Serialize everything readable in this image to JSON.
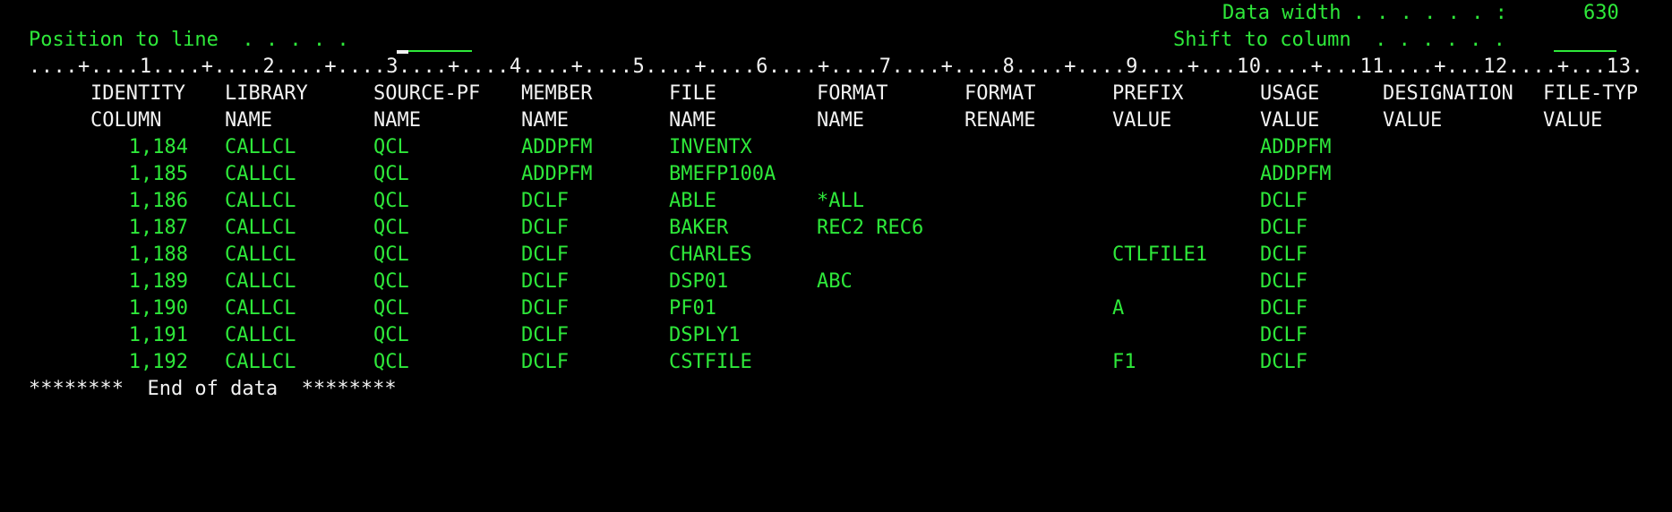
{
  "header": {
    "data_width_label": "Data width . . . . . . :",
    "data_width_value": "630",
    "position_label": "Position to line  . . . . .",
    "position_value": "",
    "shift_label": "Shift to column  . . . . . .",
    "shift_value": ""
  },
  "ruler": " . . . . + . . . . 1 . . . . + . . . . 2 . . . . + . . . . 3 . . . . + . . . . 4 . . . . + . . . . 5 . . . . + . . . . 6 . . . . + . . . . 7 . . . . + . . . . 8 . . . . + . . . . 9 . . . . + . . . 10 . . . . + . . . 11 . . . . + . . . 12 . . . . + . . . 13 .",
  "ruler_text": "....+....1....+....2....+....3....+....4....+....5....+....6....+....7....+....8....+....9....+...10....+...11....+...12....+...13.",
  "columns": [
    {
      "h1": "IDENTITY",
      "h2": "COLUMN"
    },
    {
      "h1": "LIBRARY",
      "h2": "NAME"
    },
    {
      "h1": "SOURCE-PF",
      "h2": "NAME"
    },
    {
      "h1": "MEMBER",
      "h2": "NAME"
    },
    {
      "h1": "FILE",
      "h2": "NAME"
    },
    {
      "h1": "FORMAT",
      "h2": "NAME"
    },
    {
      "h1": "FORMAT",
      "h2": "RENAME"
    },
    {
      "h1": "PREFIX",
      "h2": "VALUE"
    },
    {
      "h1": "USAGE",
      "h2": "VALUE"
    },
    {
      "h1": "DESIGNATION",
      "h2": "VALUE"
    },
    {
      "h1": "FILE-TYP",
      "h2": "VALUE"
    }
  ],
  "rows": [
    {
      "identity": "1,184",
      "library": "CALLCL",
      "source_pf": "QCL",
      "member": "ADDPFM",
      "file": "INVENTX",
      "format": "",
      "format_rename": "",
      "prefix": "",
      "usage": "ADDPFM",
      "designation": "",
      "file_type": ""
    },
    {
      "identity": "1,185",
      "library": "CALLCL",
      "source_pf": "QCL",
      "member": "ADDPFM",
      "file": "BMEFP100A",
      "format": "",
      "format_rename": "",
      "prefix": "",
      "usage": "ADDPFM",
      "designation": "",
      "file_type": ""
    },
    {
      "identity": "1,186",
      "library": "CALLCL",
      "source_pf": "QCL",
      "member": "DCLF",
      "file": "ABLE",
      "format": "*ALL",
      "format_rename": "",
      "prefix": "",
      "usage": "DCLF",
      "designation": "",
      "file_type": ""
    },
    {
      "identity": "1,187",
      "library": "CALLCL",
      "source_pf": "QCL",
      "member": "DCLF",
      "file": "BAKER",
      "format": "REC2 REC6",
      "format_rename": "",
      "prefix": "",
      "usage": "DCLF",
      "designation": "",
      "file_type": ""
    },
    {
      "identity": "1,188",
      "library": "CALLCL",
      "source_pf": "QCL",
      "member": "DCLF",
      "file": "CHARLES",
      "format": "",
      "format_rename": "",
      "prefix": "CTLFILE1",
      "usage": "DCLF",
      "designation": "",
      "file_type": ""
    },
    {
      "identity": "1,189",
      "library": "CALLCL",
      "source_pf": "QCL",
      "member": "DCLF",
      "file": "DSP01",
      "format": "ABC",
      "format_rename": "",
      "prefix": "",
      "usage": "DCLF",
      "designation": "",
      "file_type": ""
    },
    {
      "identity": "1,190",
      "library": "CALLCL",
      "source_pf": "QCL",
      "member": "DCLF",
      "file": "PF01",
      "format": "",
      "format_rename": "",
      "prefix": "A",
      "usage": "DCLF",
      "designation": "",
      "file_type": ""
    },
    {
      "identity": "1,191",
      "library": "CALLCL",
      "source_pf": "QCL",
      "member": "DCLF",
      "file": "DSPLY1",
      "format": "",
      "format_rename": "",
      "prefix": "",
      "usage": "DCLF",
      "designation": "",
      "file_type": ""
    },
    {
      "identity": "1,192",
      "library": "CALLCL",
      "source_pf": "QCL",
      "member": "DCLF",
      "file": "CSTFILE",
      "format": "",
      "format_rename": "",
      "prefix": "F1",
      "usage": "DCLF",
      "designation": "",
      "file_type": ""
    }
  ],
  "footer": {
    "end_of_data": "********  End of data  ********"
  },
  "colors": {
    "background": "#000000",
    "field_text": "#2ee83a",
    "static_text": "#f2f2f2"
  }
}
